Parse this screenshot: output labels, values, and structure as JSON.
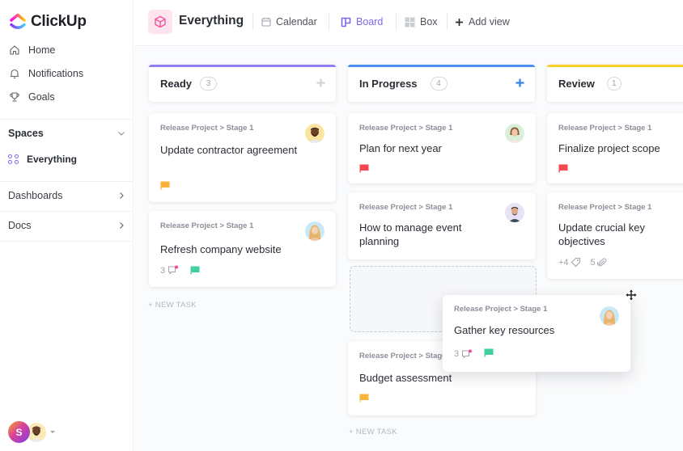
{
  "app": {
    "name": "ClickUp"
  },
  "sidebar": {
    "nav": [
      {
        "label": "Home",
        "icon": "home-icon"
      },
      {
        "label": "Notifications",
        "icon": "bell-icon"
      },
      {
        "label": "Goals",
        "icon": "trophy-icon"
      }
    ],
    "spaces_label": "Spaces",
    "space_item": "Everything",
    "sections": [
      {
        "label": "Dashboards"
      },
      {
        "label": "Docs"
      }
    ],
    "user_initial": "S"
  },
  "header": {
    "title": "Everything",
    "views": [
      {
        "label": "Calendar",
        "active": false
      },
      {
        "label": "Board",
        "active": true
      },
      {
        "label": "Box",
        "active": false
      }
    ],
    "add_view": "Add view"
  },
  "colors": {
    "accent": "#7b68ee",
    "ready": "#8f7ff2",
    "in_progress": "#4a90f0",
    "review": "#f7cf2b",
    "flag_yellow": "#f9b33b",
    "flag_red": "#f5474f",
    "flag_green": "#43d0a0"
  },
  "board": {
    "columns": [
      {
        "title": "Ready",
        "count": "3",
        "new_task": "+ NEW TASK",
        "cards": [
          {
            "crumb": "Release Project > Stage 1",
            "title": "Update contractor agreement",
            "flag": "yellow"
          },
          {
            "crumb": "Release Project > Stage 1",
            "title": "Refresh company website",
            "comments": "3",
            "flag": "green"
          }
        ]
      },
      {
        "title": "In Progress",
        "count": "4",
        "new_task": "+ NEW TASK",
        "cards": [
          {
            "crumb": "Release Project > Stage 1",
            "title": "Plan for next year",
            "flag": "red"
          },
          {
            "crumb": "Release Project > Stage 1",
            "title": "How to manage event planning"
          },
          {
            "crumb": "Release Project > Stage 1",
            "title": "Budget assessment",
            "flag": "yellow"
          }
        ]
      },
      {
        "title": "Review",
        "count": "1",
        "cards": [
          {
            "crumb": "Release Project > Stage 1",
            "title": "Finalize project scope",
            "flag": "red"
          },
          {
            "crumb": "Release Project > Stage 1",
            "title": "Update crucial key objectives",
            "tags": "+4",
            "attachments": "5"
          }
        ]
      }
    ],
    "dragging_card": {
      "crumb": "Release Project > Stage 1",
      "title": "Gather key resources",
      "comments": "3",
      "flag": "green"
    }
  }
}
